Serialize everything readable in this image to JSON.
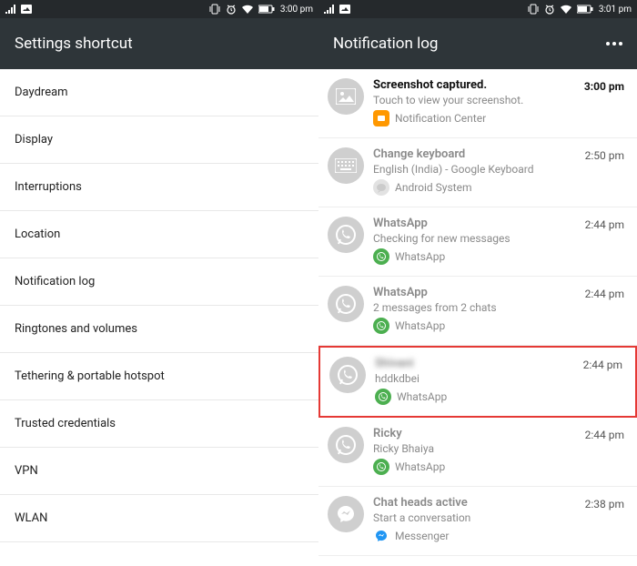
{
  "left": {
    "status": {
      "time": "3:00 pm"
    },
    "header": {
      "title": "Settings shortcut"
    },
    "items": [
      {
        "label": "Daydream"
      },
      {
        "label": "Display"
      },
      {
        "label": "Interruptions"
      },
      {
        "label": "Location"
      },
      {
        "label": "Notification log"
      },
      {
        "label": "Ringtones and volumes"
      },
      {
        "label": "Tethering & portable hotspot"
      },
      {
        "label": "Trusted credentials"
      },
      {
        "label": "VPN"
      },
      {
        "label": "WLAN"
      }
    ]
  },
  "right": {
    "status": {
      "time": "3:01 pm"
    },
    "header": {
      "title": "Notification log"
    },
    "items": [
      {
        "title": "Screenshot captured.",
        "desc": "Touch to view your screenshot.",
        "app": "Notification Center",
        "time": "3:00 pm",
        "icon": "picture-icon",
        "app_icon": "app-orange",
        "active": true
      },
      {
        "title": "Change keyboard",
        "desc": "English (India) - Google Keyboard",
        "app": "Android System",
        "time": "2:50 pm",
        "icon": "keyboard-icon",
        "app_icon": "app-gray-bubble"
      },
      {
        "title": "WhatsApp",
        "desc": "Checking for new messages",
        "app": "WhatsApp",
        "time": "2:44 pm",
        "icon": "whatsapp-icon",
        "app_icon": "app-whatsapp"
      },
      {
        "title": "WhatsApp",
        "desc": "2 messages from 2 chats",
        "app": "WhatsApp",
        "time": "2:44 pm",
        "icon": "whatsapp-icon",
        "app_icon": "app-whatsapp"
      },
      {
        "title": "Shivani",
        "desc": "hddkdbei",
        "app": "WhatsApp",
        "time": "2:44 pm",
        "icon": "whatsapp-icon",
        "app_icon": "app-whatsapp",
        "highlight": true,
        "blurred": true
      },
      {
        "title": "Ricky",
        "desc": "Ricky Bhaiya",
        "app": "WhatsApp",
        "time": "2:44 pm",
        "icon": "whatsapp-icon",
        "app_icon": "app-whatsapp"
      },
      {
        "title": "Chat heads active",
        "desc": "Start a conversation",
        "app": "Messenger",
        "time": "2:38 pm",
        "icon": "messenger-icon",
        "app_icon": "app-messenger"
      }
    ]
  }
}
